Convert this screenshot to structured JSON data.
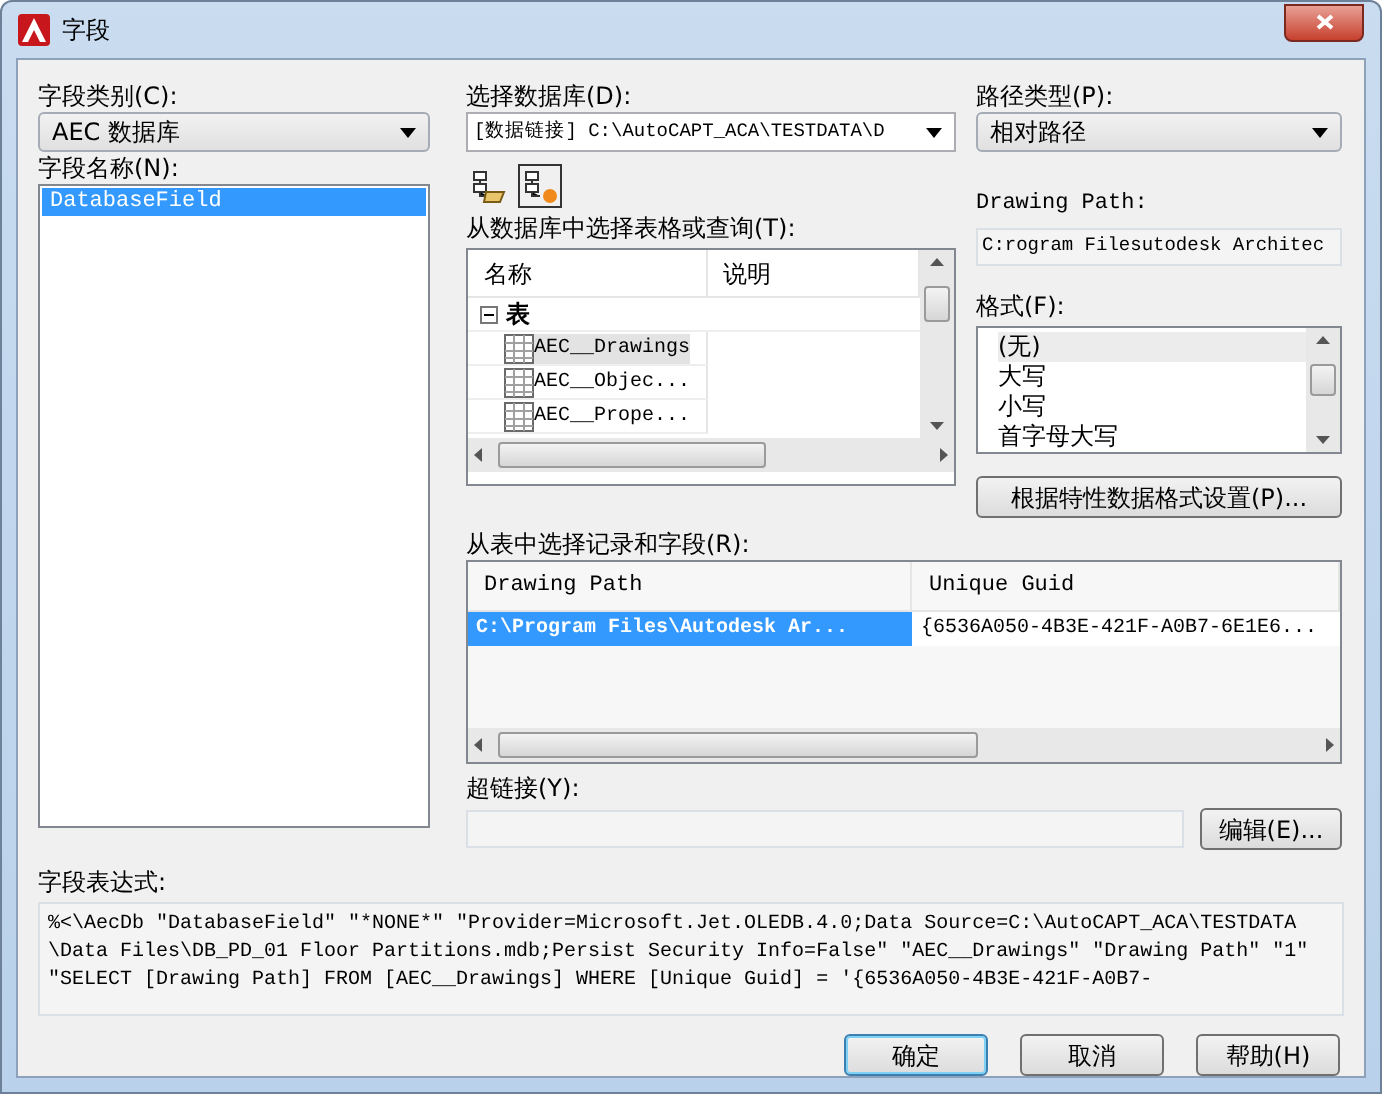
{
  "window": {
    "title": "字段"
  },
  "field_category": {
    "label": "字段类别(C):",
    "value": "AEC 数据库"
  },
  "field_names": {
    "label": "字段名称(N):",
    "items": [
      {
        "text": "DatabaseField",
        "selected": true
      }
    ]
  },
  "database": {
    "label": "选择数据库(D):",
    "value": "[数据链接] C:\\AutoCAPT_ACA\\TESTDATA\\D"
  },
  "toolbar": [
    {
      "kind": "open",
      "selected": false
    },
    {
      "kind": "new",
      "selected": true
    }
  ],
  "tables": {
    "label": "从数据库中选择表格或查询(T):",
    "columns": [
      "名称",
      "说明"
    ],
    "tree": [
      {
        "text": "表",
        "expanded": true,
        "children": [
          {
            "text": "AEC__Drawings",
            "selected": true
          },
          {
            "text": "AEC__Objec...",
            "selected": false
          },
          {
            "text": "AEC__Prope...",
            "selected": false
          }
        ]
      }
    ]
  },
  "path_type": {
    "label": "路径类型(P):",
    "value": "相对路径"
  },
  "drawing_path": {
    "label": "Drawing Path:",
    "value": "C:rogram Filesutodesk Architec"
  },
  "format": {
    "label": "格式(F):",
    "items": [
      {
        "text": "(无)",
        "selected": true
      },
      {
        "text": "大写",
        "selected": false
      },
      {
        "text": "小写",
        "selected": false
      },
      {
        "text": "首字母大写",
        "selected": false
      }
    ]
  },
  "format_button": "根据特性数据格式设置(P)...",
  "records": {
    "label": "从表中选择记录和字段(R):",
    "columns": [
      "Drawing Path",
      "Unique Guid"
    ],
    "rows": [
      {
        "cells": [
          "C:\\Program Files\\Autodesk Ar...",
          "{6536A050-4B3E-421F-A0B7-6E1E6..."
        ],
        "selected": true
      }
    ]
  },
  "hyperlink": {
    "label": "超链接(Y):",
    "button": "编辑(E)..."
  },
  "expression": {
    "label": "字段表达式:",
    "lines": [
      "%<\\AecDb \"DatabaseField\" \"*NONE*\" \"Provider=Microsoft.Jet.OLEDB.4.0;Data Source=C:\\AutoCAPT_ACA\\TESTDATA",
      "\\Data Files\\DB_PD_01 Floor Partitions.mdb;Persist Security Info=False\" \"AEC__Drawings\" \"Drawing Path\" \"1\"",
      "\"SELECT [Drawing Path] FROM [AEC__Drawings] WHERE [Unique Guid] = '{6536A050-4B3E-421F-A0B7-"
    ]
  },
  "buttons": [
    {
      "text": "确定",
      "default": true
    },
    {
      "text": "取消",
      "default": false
    },
    {
      "text": "帮助(H)",
      "default": false
    }
  ]
}
